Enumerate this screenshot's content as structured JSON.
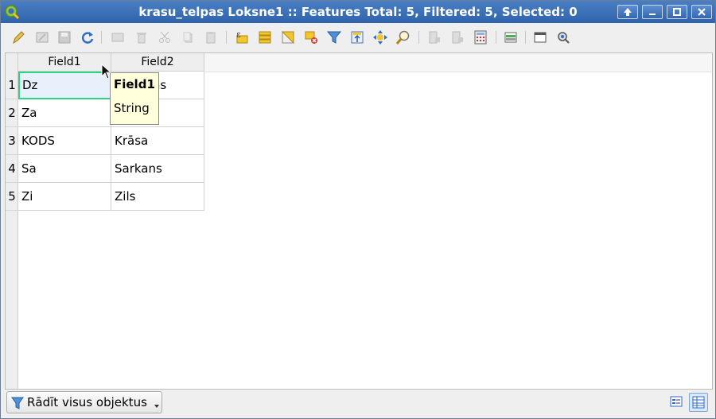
{
  "window": {
    "title": "krasu_telpas Loksne1 :: Features Total: 5, Filtered: 5, Selected: 0",
    "app_icon": "qgis-icon",
    "controls": [
      "up-icon",
      "minimize-icon",
      "maximize-icon",
      "close-icon"
    ]
  },
  "toolbar": {
    "buttons": [
      {
        "name": "toggle-editing",
        "icon": "pencil-icon"
      },
      {
        "name": "toggle-multiedit",
        "icon": "multiedit-icon"
      },
      {
        "name": "save-edits",
        "icon": "save-icon"
      },
      {
        "name": "reload-table",
        "icon": "refresh-icon"
      },
      {
        "name": "add-feature",
        "icon": "add-feature-icon"
      },
      {
        "name": "delete-selected",
        "icon": "trash-icon"
      },
      {
        "name": "cut",
        "icon": "scissors-icon"
      },
      {
        "name": "copy",
        "icon": "copy-icon"
      },
      {
        "name": "paste",
        "icon": "paste-icon"
      },
      {
        "name": "select-by-expression",
        "icon": "expression-select-icon"
      },
      {
        "name": "select-all",
        "icon": "select-all-icon"
      },
      {
        "name": "invert-selection",
        "icon": "invert-selection-icon"
      },
      {
        "name": "deselect-all",
        "icon": "deselect-icon"
      },
      {
        "name": "filter-select",
        "icon": "filter-icon"
      },
      {
        "name": "move-selection-top",
        "icon": "move-top-icon"
      },
      {
        "name": "pan-to-selected",
        "icon": "pan-icon"
      },
      {
        "name": "zoom-to-selected",
        "icon": "zoom-icon"
      },
      {
        "name": "new-field",
        "icon": "new-field-icon"
      },
      {
        "name": "delete-field",
        "icon": "delete-field-icon"
      },
      {
        "name": "field-calculator",
        "icon": "calculator-icon"
      },
      {
        "name": "conditional-formatting",
        "icon": "conditional-format-icon"
      },
      {
        "name": "dock-table",
        "icon": "dock-icon"
      },
      {
        "name": "actions",
        "icon": "actions-icon"
      }
    ]
  },
  "table": {
    "columns": [
      "Field1",
      "Field2"
    ],
    "rows": [
      {
        "num": "1",
        "field1": "Dz",
        "field2": "Dzeltens"
      },
      {
        "num": "2",
        "field1": "Za",
        "field2": "Zaļš"
      },
      {
        "num": "3",
        "field1": "KODS",
        "field2": "Krāsa"
      },
      {
        "num": "4",
        "field1": "Sa",
        "field2": "Sarkans"
      },
      {
        "num": "5",
        "field1": "Zi",
        "field2": "Zils"
      }
    ],
    "selected_cell": {
      "row": 1,
      "column": "Field1"
    }
  },
  "tooltip": {
    "title": "Field1",
    "type": "String"
  },
  "bottom": {
    "filter_label": "Rādīt visus objektus",
    "views": [
      "form-view-icon",
      "table-view-icon"
    ],
    "active_view": "table-view-icon"
  },
  "colors": {
    "titlebar": "#3a6fb8",
    "selection_border": "#2ed47e",
    "tooltip_bg": "#ffffdc"
  }
}
